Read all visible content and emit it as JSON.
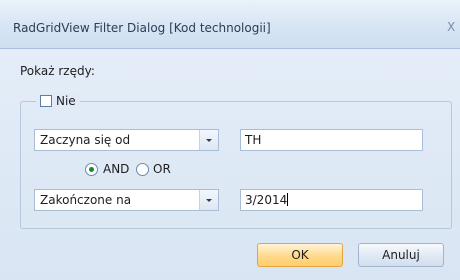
{
  "window": {
    "title": "RadGridView Filter Dialog [Kod technologii]",
    "close_glyph": "X"
  },
  "show_rows_label": "Pokaż rzędy:",
  "negate": {
    "label": "Nie",
    "checked": false
  },
  "filter1": {
    "operator": "Zaczyna się od",
    "value": "TH"
  },
  "logic": {
    "and_label": "AND",
    "or_label": "OR",
    "selected": "AND"
  },
  "filter2": {
    "operator": "Zakończone na",
    "value": "3/2014"
  },
  "buttons": {
    "ok_label": "OK",
    "cancel_label": "Anuluj"
  },
  "colors": {
    "selected_radio": "#1b8a2a",
    "ok_button": "#ffd98c"
  }
}
